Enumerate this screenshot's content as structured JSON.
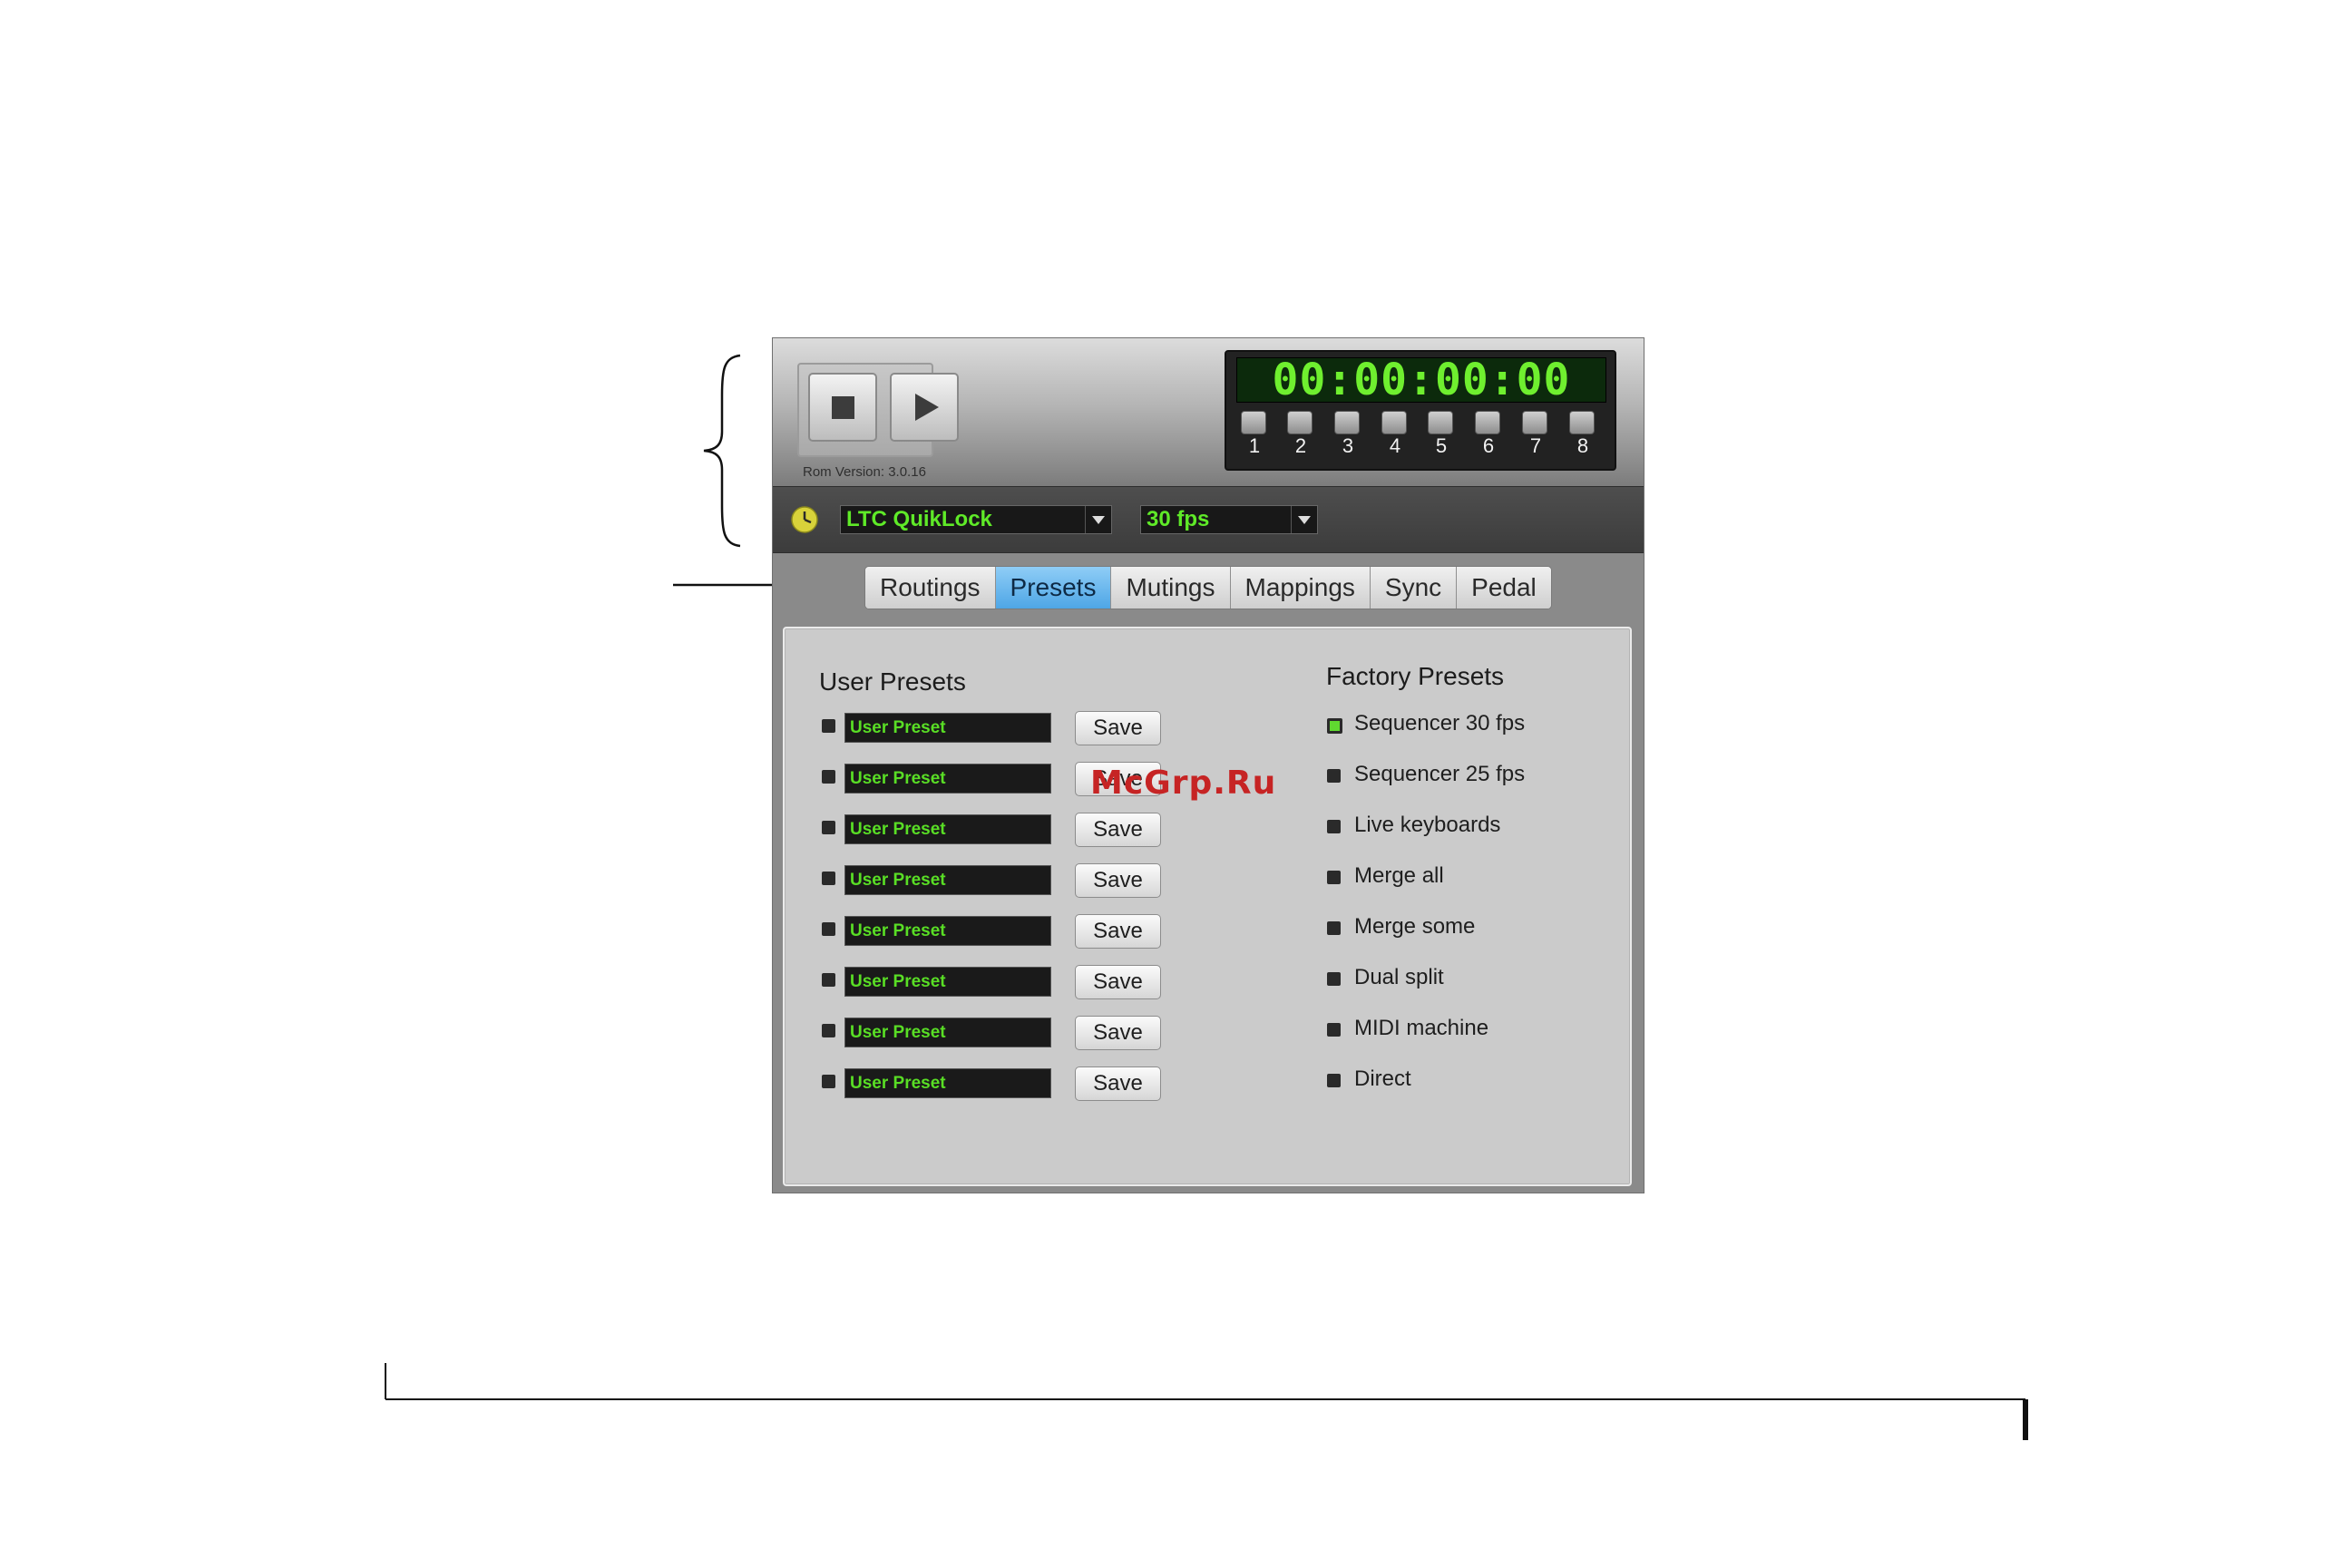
{
  "watermark": "McGrp.Ru",
  "header": {
    "rom_version": "Rom Version: 3.0.16",
    "timecode": "00:00:00:00",
    "port_buttons": [
      "1",
      "2",
      "3",
      "4",
      "5",
      "6",
      "7",
      "8"
    ]
  },
  "sync": {
    "source": "LTC QuikLock",
    "frame_rate": "30 fps"
  },
  "tabs": [
    {
      "label": "Routings",
      "active": false
    },
    {
      "label": "Presets",
      "active": true
    },
    {
      "label": "Mutings",
      "active": false
    },
    {
      "label": "Mappings",
      "active": false
    },
    {
      "label": "Sync",
      "active": false
    },
    {
      "label": "Pedal",
      "active": false
    }
  ],
  "user_presets": {
    "heading": "User Presets",
    "save_label": "Save",
    "items": [
      "User Preset",
      "User Preset",
      "User Preset",
      "User Preset",
      "User Preset",
      "User Preset",
      "User Preset",
      "User Preset"
    ]
  },
  "factory_presets": {
    "heading": "Factory Presets",
    "selected_index": 0,
    "items": [
      "Sequencer 30 fps",
      "Sequencer 25 fps",
      "Live keyboards",
      "Merge all",
      "Merge some",
      "Dual split",
      "MIDI machine",
      "Direct"
    ]
  },
  "colors": {
    "accent_green": "#5fea28",
    "active_tab": "#4ea6e6",
    "clock_icon": "#d8d23a"
  }
}
